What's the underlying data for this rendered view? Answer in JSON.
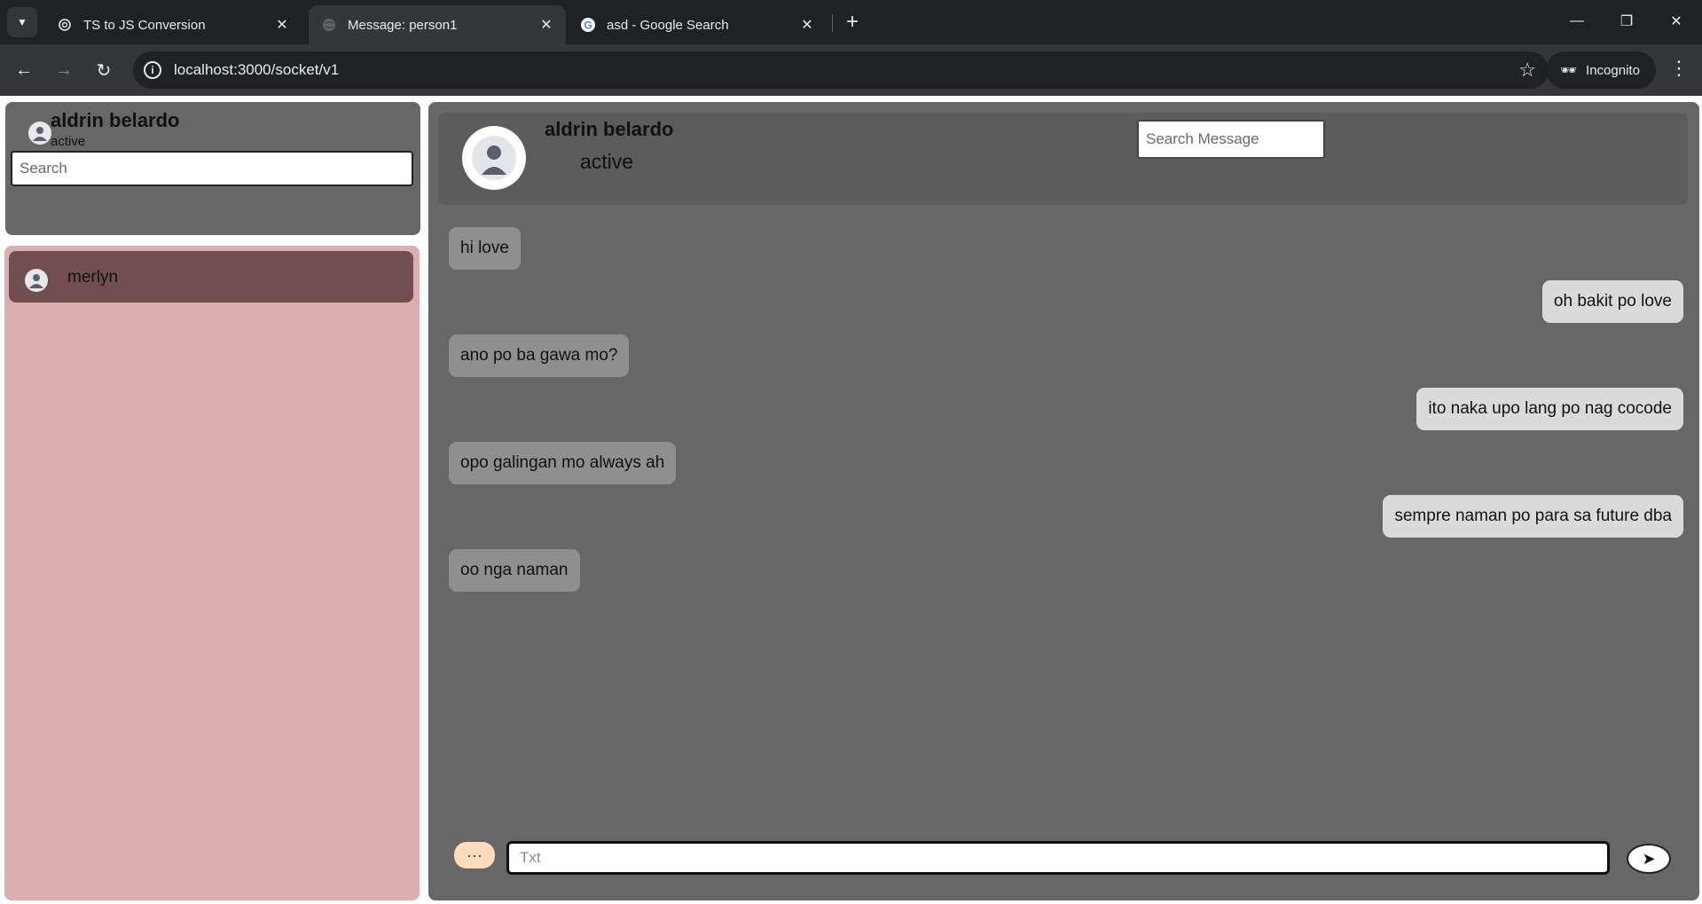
{
  "browser": {
    "tabs": [
      {
        "title": "TS to JS Conversion",
        "icon": "openai-icon",
        "active": false
      },
      {
        "title": "Message: person1",
        "icon": "globe-icon",
        "active": true
      },
      {
        "title": "asd - Google Search",
        "icon": "google-icon",
        "active": false
      }
    ],
    "url": "localhost:3000/socket/v1",
    "incognito_label": "Incognito"
  },
  "profile": {
    "name": "aldrin belardo",
    "status": "active",
    "search_placeholder": "Search"
  },
  "contacts": [
    {
      "name": "merlyn"
    }
  ],
  "chat": {
    "name": "aldrin belardo",
    "status": "active",
    "search_placeholder": "Search Message",
    "messages": [
      {
        "text": "hi love",
        "direction": "in"
      },
      {
        "text": "oh bakit po love",
        "direction": "out"
      },
      {
        "text": "ano po ba gawa mo?",
        "direction": "in"
      },
      {
        "text": "ito naka upo lang po nag cocode",
        "direction": "out"
      },
      {
        "text": "opo galingan mo always ah",
        "direction": "in"
      },
      {
        "text": "sempre naman po para sa future dba",
        "direction": "out"
      },
      {
        "text": "oo nga naman",
        "direction": "in"
      }
    ],
    "input_placeholder": "Txt",
    "emoji_button": "···",
    "send_icon": "send-arrow-icon"
  },
  "colors": {
    "profile_panel": "#676767",
    "contacts_panel": "#dcaeb0",
    "contact_selected": "#714f51",
    "chat_panel": "#676767",
    "bubble_in": "#8f8f8f",
    "bubble_out": "#dadada",
    "emoji_button": "#fcdcba"
  }
}
